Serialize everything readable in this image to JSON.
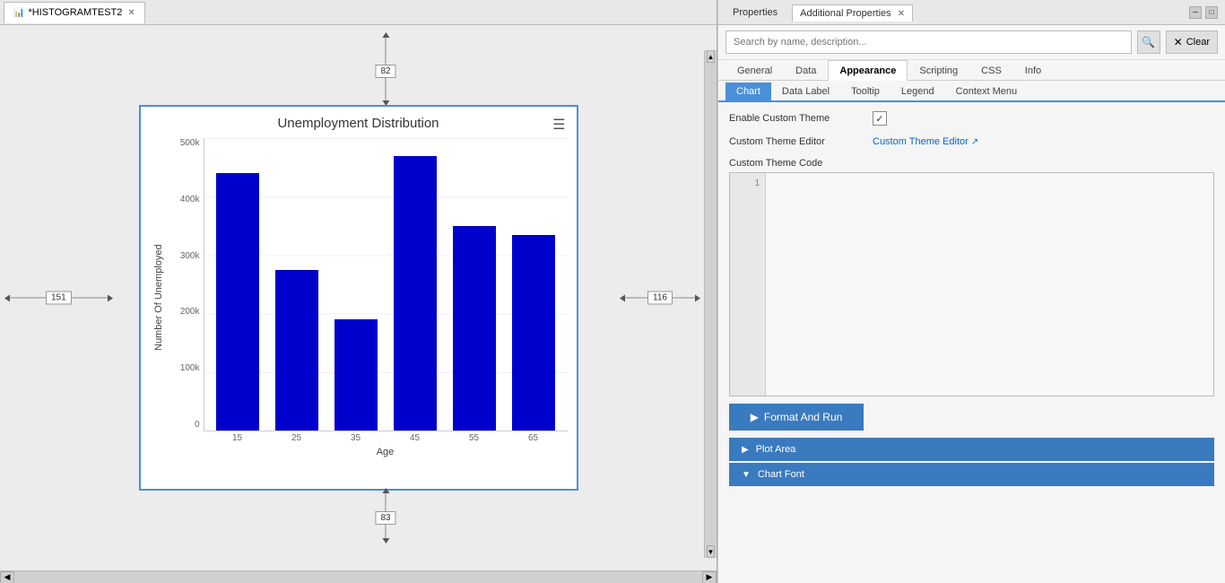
{
  "left_panel": {
    "tab_label": "*HISTOGRAMTEST2",
    "ruler_top": "82",
    "ruler_bottom": "83",
    "ruler_left": "151",
    "ruler_right": "116",
    "chart": {
      "title": "Unemployment Distribution",
      "x_axis_label": "Age",
      "y_axis_label": "Number Of Unemployed",
      "y_ticks": [
        "500k",
        "400k",
        "300k",
        "200k",
        "100k",
        "0"
      ],
      "x_labels": [
        "15",
        "25",
        "35",
        "45",
        "55",
        "65"
      ],
      "bars": [
        {
          "label": "15",
          "height_pct": 88
        },
        {
          "label": "25",
          "height_pct": 55
        },
        {
          "label": "35",
          "height_pct": 38
        },
        {
          "label": "45",
          "height_pct": 94
        },
        {
          "label": "55",
          "height_pct": 70
        },
        {
          "label": "65",
          "height_pct": 67
        }
      ]
    }
  },
  "right_panel": {
    "tab_properties": "Properties",
    "tab_additional": "Additional Properties",
    "search_placeholder": "Search by name, description...",
    "clear_label": "Clear",
    "prop_tabs": {
      "general": "General",
      "data": "Data",
      "appearance": "Appearance",
      "scripting": "Scripting",
      "css": "CSS",
      "info": "Info"
    },
    "sub_tabs": {
      "chart": "Chart",
      "data_label": "Data Label",
      "tooltip": "Tooltip",
      "legend": "Legend",
      "context_menu": "Context Menu"
    },
    "enable_custom_theme_label": "Enable Custom Theme",
    "custom_theme_editor_label": "Custom Theme Editor",
    "custom_theme_editor_link": "Custom Theme Editor",
    "custom_theme_code_label": "Custom Theme Code",
    "format_run_btn": "Format And Run",
    "plot_area_btn": "Plot Area",
    "chart_font_btn": "Chart Font",
    "line_number": "1"
  }
}
